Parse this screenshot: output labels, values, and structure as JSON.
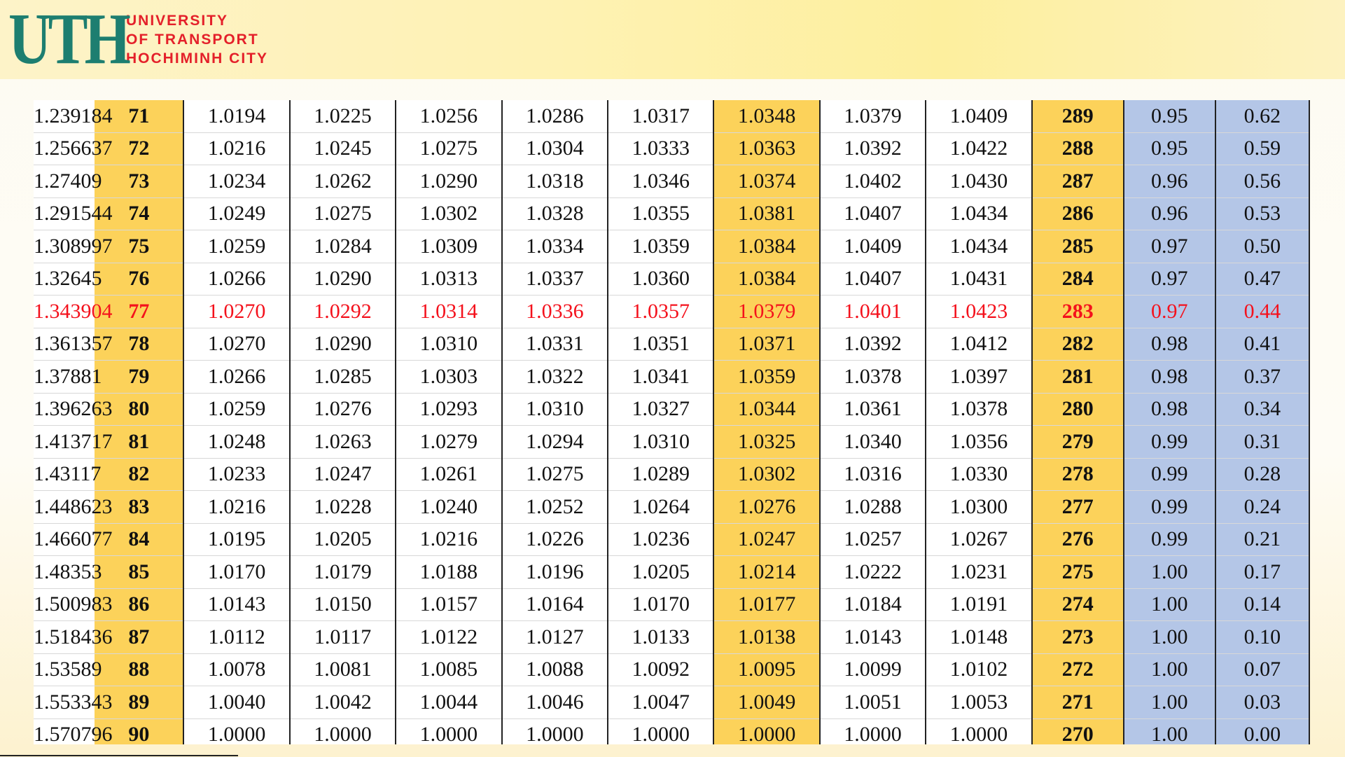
{
  "header": {
    "logo_mark": "UTH",
    "logo_lines": [
      "UNIVERSITY",
      "OF TRANSPORT",
      "HOCHIMINH CITY"
    ]
  },
  "colors": {
    "yellow_column": "#fcd25a",
    "blue_column": "#b4c6e7",
    "highlight_text": "#f4111c",
    "logo_green": "#1d7e70",
    "logo_red": "#e4202a"
  },
  "highlighted_row_index": 6,
  "table": {
    "rows": [
      [
        "1.239184",
        "71",
        "1.0194",
        "1.0225",
        "1.0256",
        "1.0286",
        "1.0317",
        "1.0348",
        "1.0379",
        "1.0409",
        "289",
        "0.95",
        "0.62"
      ],
      [
        "1.256637",
        "72",
        "1.0216",
        "1.0245",
        "1.0275",
        "1.0304",
        "1.0333",
        "1.0363",
        "1.0392",
        "1.0422",
        "288",
        "0.95",
        "0.59"
      ],
      [
        "1.27409",
        "73",
        "1.0234",
        "1.0262",
        "1.0290",
        "1.0318",
        "1.0346",
        "1.0374",
        "1.0402",
        "1.0430",
        "287",
        "0.96",
        "0.56"
      ],
      [
        "1.291544",
        "74",
        "1.0249",
        "1.0275",
        "1.0302",
        "1.0328",
        "1.0355",
        "1.0381",
        "1.0407",
        "1.0434",
        "286",
        "0.96",
        "0.53"
      ],
      [
        "1.308997",
        "75",
        "1.0259",
        "1.0284",
        "1.0309",
        "1.0334",
        "1.0359",
        "1.0384",
        "1.0409",
        "1.0434",
        "285",
        "0.97",
        "0.50"
      ],
      [
        "1.32645",
        "76",
        "1.0266",
        "1.0290",
        "1.0313",
        "1.0337",
        "1.0360",
        "1.0384",
        "1.0407",
        "1.0431",
        "284",
        "0.97",
        "0.47"
      ],
      [
        "1.343904",
        "77",
        "1.0270",
        "1.0292",
        "1.0314",
        "1.0336",
        "1.0357",
        "1.0379",
        "1.0401",
        "1.0423",
        "283",
        "0.97",
        "0.44"
      ],
      [
        "1.361357",
        "78",
        "1.0270",
        "1.0290",
        "1.0310",
        "1.0331",
        "1.0351",
        "1.0371",
        "1.0392",
        "1.0412",
        "282",
        "0.98",
        "0.41"
      ],
      [
        "1.37881",
        "79",
        "1.0266",
        "1.0285",
        "1.0303",
        "1.0322",
        "1.0341",
        "1.0359",
        "1.0378",
        "1.0397",
        "281",
        "0.98",
        "0.37"
      ],
      [
        "1.396263",
        "80",
        "1.0259",
        "1.0276",
        "1.0293",
        "1.0310",
        "1.0327",
        "1.0344",
        "1.0361",
        "1.0378",
        "280",
        "0.98",
        "0.34"
      ],
      [
        "1.413717",
        "81",
        "1.0248",
        "1.0263",
        "1.0279",
        "1.0294",
        "1.0310",
        "1.0325",
        "1.0340",
        "1.0356",
        "279",
        "0.99",
        "0.31"
      ],
      [
        "1.43117",
        "82",
        "1.0233",
        "1.0247",
        "1.0261",
        "1.0275",
        "1.0289",
        "1.0302",
        "1.0316",
        "1.0330",
        "278",
        "0.99",
        "0.28"
      ],
      [
        "1.448623",
        "83",
        "1.0216",
        "1.0228",
        "1.0240",
        "1.0252",
        "1.0264",
        "1.0276",
        "1.0288",
        "1.0300",
        "277",
        "0.99",
        "0.24"
      ],
      [
        "1.466077",
        "84",
        "1.0195",
        "1.0205",
        "1.0216",
        "1.0226",
        "1.0236",
        "1.0247",
        "1.0257",
        "1.0267",
        "276",
        "0.99",
        "0.21"
      ],
      [
        "1.48353",
        "85",
        "1.0170",
        "1.0179",
        "1.0188",
        "1.0196",
        "1.0205",
        "1.0214",
        "1.0222",
        "1.0231",
        "275",
        "1.00",
        "0.17"
      ],
      [
        "1.500983",
        "86",
        "1.0143",
        "1.0150",
        "1.0157",
        "1.0164",
        "1.0170",
        "1.0177",
        "1.0184",
        "1.0191",
        "274",
        "1.00",
        "0.14"
      ],
      [
        "1.518436",
        "87",
        "1.0112",
        "1.0117",
        "1.0122",
        "1.0127",
        "1.0133",
        "1.0138",
        "1.0143",
        "1.0148",
        "273",
        "1.00",
        "0.10"
      ],
      [
        "1.53589",
        "88",
        "1.0078",
        "1.0081",
        "1.0085",
        "1.0088",
        "1.0092",
        "1.0095",
        "1.0099",
        "1.0102",
        "272",
        "1.00",
        "0.07"
      ],
      [
        "1.553343",
        "89",
        "1.0040",
        "1.0042",
        "1.0044",
        "1.0046",
        "1.0047",
        "1.0049",
        "1.0051",
        "1.0053",
        "271",
        "1.00",
        "0.03"
      ],
      [
        "1.570796",
        "90",
        "1.0000",
        "1.0000",
        "1.0000",
        "1.0000",
        "1.0000",
        "1.0000",
        "1.0000",
        "1.0000",
        "270",
        "1.00",
        "0.00"
      ]
    ]
  }
}
